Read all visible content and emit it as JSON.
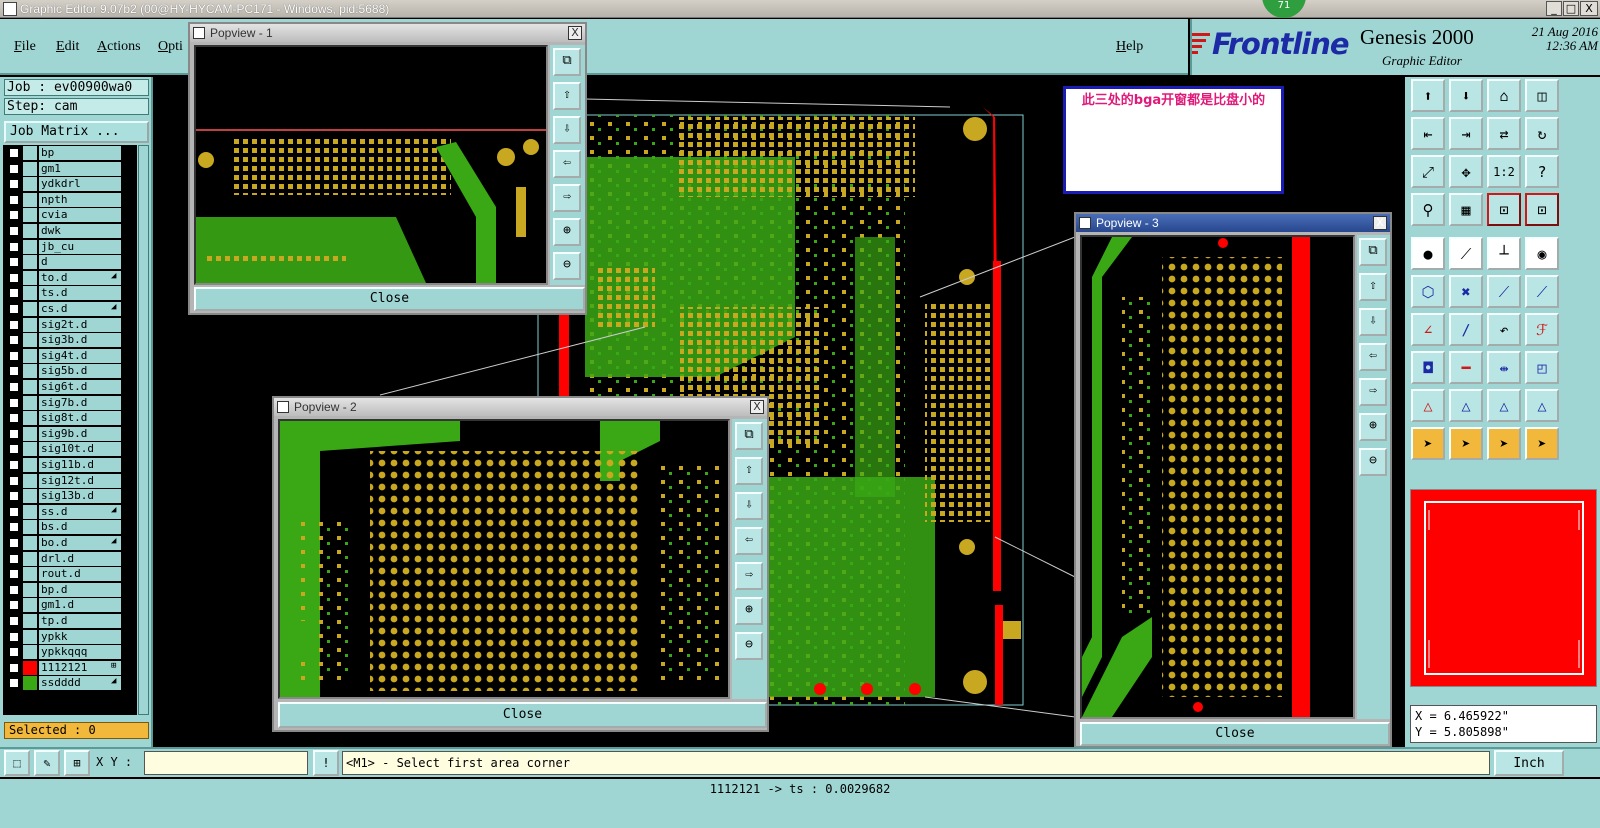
{
  "window": {
    "title": "Graphic Editor 9.07b2 (00@HY-HYCAM-PC171 - Windows, pid:5688)",
    "badge": "71",
    "minimize": "_",
    "maximize": "□",
    "close": "X"
  },
  "menu": {
    "file": "File",
    "edit": "Edit",
    "actions": "Actions",
    "options": "Opti",
    "help": "Help"
  },
  "brand": {
    "logo": "Frontline",
    "product": "Genesis 2000",
    "subtitle": "Graphic Editor",
    "date": "21 Aug 2016",
    "time": "12:36 AM"
  },
  "left_panel": {
    "job": "Job : ev00900wa0",
    "step": "Step: cam",
    "job_matrix": "Job Matrix ...",
    "layers": [
      {
        "name": "bp",
        "color": "#9fd6d4",
        "hook": ""
      },
      {
        "name": "gm1",
        "color": "#9fd6d4",
        "hook": ""
      },
      {
        "name": "ydkdrl",
        "color": "#9fd6d4",
        "hook": ""
      },
      {
        "name": "npth",
        "color": "#9fd6d4",
        "hook": ""
      },
      {
        "name": "cvia",
        "color": "#9fd6d4",
        "hook": ""
      },
      {
        "name": "dwk",
        "color": "#9fd6d4",
        "hook": ""
      },
      {
        "name": "jb_cu",
        "color": "#9fd6d4",
        "hook": ""
      },
      {
        "name": "d",
        "color": "#9fd6d4",
        "hook": ""
      },
      {
        "name": "to.d",
        "color": "#9fd6d4",
        "hook": "◢"
      },
      {
        "name": "ts.d",
        "color": "#9fd6d4",
        "hook": ""
      },
      {
        "name": "cs.d",
        "color": "#9fd6d4",
        "hook": "◢"
      },
      {
        "name": "sig2t.d",
        "color": "#9fd6d4",
        "hook": ""
      },
      {
        "name": "sig3b.d",
        "color": "#9fd6d4",
        "hook": ""
      },
      {
        "name": "sig4t.d",
        "color": "#9fd6d4",
        "hook": ""
      },
      {
        "name": "sig5b.d",
        "color": "#9fd6d4",
        "hook": ""
      },
      {
        "name": "sig6t.d",
        "color": "#9fd6d4",
        "hook": ""
      },
      {
        "name": "sig7b.d",
        "color": "#9fd6d4",
        "hook": ""
      },
      {
        "name": "sig8t.d",
        "color": "#9fd6d4",
        "hook": ""
      },
      {
        "name": "sig9b.d",
        "color": "#9fd6d4",
        "hook": ""
      },
      {
        "name": "sig10t.d",
        "color": "#9fd6d4",
        "hook": ""
      },
      {
        "name": "sig11b.d",
        "color": "#9fd6d4",
        "hook": ""
      },
      {
        "name": "sig12t.d",
        "color": "#9fd6d4",
        "hook": ""
      },
      {
        "name": "sig13b.d",
        "color": "#9fd6d4",
        "hook": ""
      },
      {
        "name": "ss.d",
        "color": "#9fd6d4",
        "hook": "◢"
      },
      {
        "name": "bs.d",
        "color": "#9fd6d4",
        "hook": ""
      },
      {
        "name": "bo.d",
        "color": "#9fd6d4",
        "hook": "◢"
      },
      {
        "name": "drl.d",
        "color": "#9fd6d4",
        "hook": ""
      },
      {
        "name": "rout.d",
        "color": "#9fd6d4",
        "hook": ""
      },
      {
        "name": "bp.d",
        "color": "#9fd6d4",
        "hook": ""
      },
      {
        "name": "gm1.d",
        "color": "#9fd6d4",
        "hook": ""
      },
      {
        "name": "tp.d",
        "color": "#9fd6d4",
        "hook": ""
      },
      {
        "name": "ypkk",
        "color": "#9fd6d4",
        "hook": ""
      },
      {
        "name": "ypkkqqq",
        "color": "#9fd6d4",
        "hook": ""
      },
      {
        "name": "1112121",
        "color": "#ff0000",
        "hook": "⊞"
      },
      {
        "name": "ssdddd",
        "color": "#3aa815",
        "hook": "◢"
      }
    ],
    "selected": "Selected : 0"
  },
  "popviews": [
    {
      "title": "Popview - 1",
      "close": "Close",
      "x_label": "X"
    },
    {
      "title": "Popview - 2",
      "close": "Close",
      "x_label": "X"
    },
    {
      "title": "Popview - 3",
      "close": "Close",
      "x_label": "X"
    }
  ],
  "annotation": "此三处的bga开窗都是比盘小的",
  "toolbox": {
    "scale_label": "1:2",
    "help_label": "?"
  },
  "coords": {
    "x": "X = 6.465922\"",
    "y": "Y = 5.805898\""
  },
  "command": {
    "xy_label": "X Y :",
    "xy_value": "",
    "excl": "!",
    "prompt": "<M1> - Select first area corner",
    "unit": "Inch"
  },
  "status": "1112121 -> ts : 0.0029682",
  "colors": {
    "panel": "#9fd6d4",
    "green": "#3aa815",
    "pad": "#c8a820",
    "red": "#ff0000"
  }
}
